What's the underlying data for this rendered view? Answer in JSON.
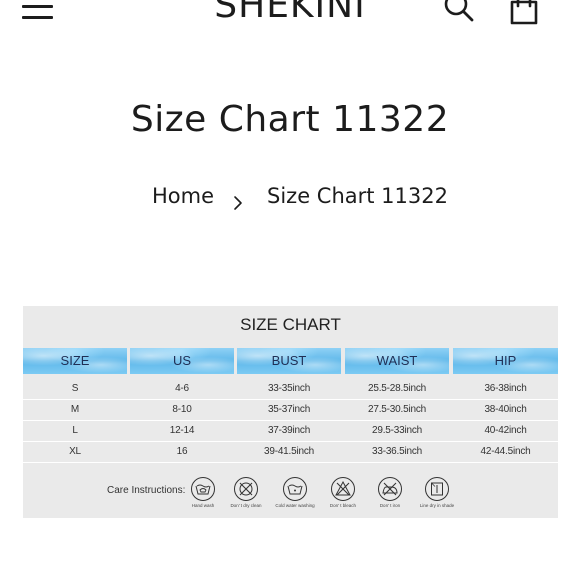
{
  "header": {
    "logo": "SHEKINI",
    "menu_icon": "hamburger-menu-icon",
    "search_icon": "search-icon",
    "cart_icon": "shopping-bag-icon"
  },
  "page": {
    "title": "Size Chart 11322"
  },
  "breadcrumb": {
    "home": "Home",
    "separator_icon": "chevron-right-icon",
    "current": "Size Chart 11322"
  },
  "size_chart": {
    "title": "SIZE CHART",
    "header_color": "#6cc1ee",
    "background_color": "#eaeaea",
    "columns": [
      "SIZE",
      "US",
      "BUST",
      "WAIST",
      "HIP"
    ],
    "rows": [
      [
        "S",
        "4-6",
        "33-35inch",
        "25.5-28.5inch",
        "36-38inch"
      ],
      [
        "M",
        "8-10",
        "35-37inch",
        "27.5-30.5inch",
        "38-40inch"
      ],
      [
        "L",
        "12-14",
        "37-39inch",
        "29.5-33inch",
        "40-42inch"
      ],
      [
        "XL",
        "16",
        "39-41.5inch",
        "33-36.5inch",
        "42-44.5inch"
      ]
    ],
    "care": {
      "label": "Care Instructions:",
      "items": [
        {
          "icon": "hand-wash-icon",
          "caption": "Hand wash"
        },
        {
          "icon": "do-not-dry-clean-icon",
          "caption": "Don' t dry clean"
        },
        {
          "icon": "cold-water-washing-icon",
          "caption": "Cold water washing"
        },
        {
          "icon": "do-not-bleach-icon",
          "caption": "Don' t bleach"
        },
        {
          "icon": "do-not-iron-icon",
          "caption": "Don' t iron"
        },
        {
          "icon": "line-dry-in-shade-icon",
          "caption": "Line dry in shade"
        }
      ]
    }
  }
}
